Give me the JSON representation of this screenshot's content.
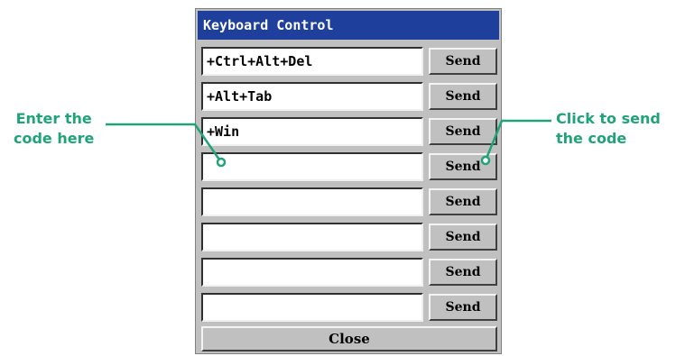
{
  "dialog": {
    "title": "Keyboard Control",
    "send_label": "Send",
    "close_label": "Close",
    "rows": [
      {
        "value": "+Ctrl+Alt+Del"
      },
      {
        "value": "+Alt+Tab"
      },
      {
        "value": "+Win"
      },
      {
        "value": ""
      },
      {
        "value": ""
      },
      {
        "value": ""
      },
      {
        "value": ""
      },
      {
        "value": ""
      }
    ]
  },
  "annotations": {
    "left_line1": "Enter the",
    "left_line2": "code here",
    "right_line1": "Click to send",
    "right_line2": "the code",
    "color": "#21a37a"
  },
  "colors": {
    "title_bar": "#1e3f9c",
    "dialog_bg": "#c0c0c0"
  }
}
